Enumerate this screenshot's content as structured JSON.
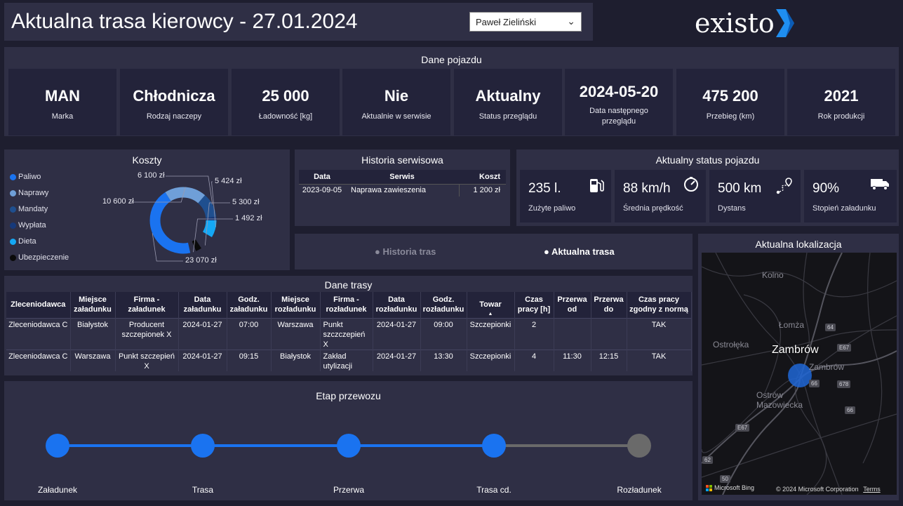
{
  "header": {
    "title": "Aktualna trasa kierowcy - 27.01.2024",
    "driver_selected": "Paweł Zieliński",
    "logo_text": "existo"
  },
  "vehicle": {
    "title": "Dane pojazdu",
    "kpis": [
      {
        "value": "MAN",
        "label": "Marka"
      },
      {
        "value": "Chłodnicza",
        "label": "Rodzaj naczepy"
      },
      {
        "value": "25 000",
        "label": "Ładowność [kg]"
      },
      {
        "value": "Nie",
        "label": "Aktualnie w serwisie"
      },
      {
        "value": "Aktualny",
        "label": "Status przeglądu"
      },
      {
        "value": "2024-05-20",
        "label": "Data następnego przeglądu"
      },
      {
        "value": "475 200",
        "label": "Przebieg (km)"
      },
      {
        "value": "2021",
        "label": "Rok produkcji"
      }
    ]
  },
  "costs": {
    "title": "Koszty",
    "legend": [
      {
        "name": "Paliwo",
        "color": "#1a73f0"
      },
      {
        "name": "Naprawy",
        "color": "#6f9fd8"
      },
      {
        "name": "Mandaty",
        "color": "#1f4f8f"
      },
      {
        "name": "Wypłata",
        "color": "#16397a"
      },
      {
        "name": "Dieta",
        "color": "#14a8f5"
      },
      {
        "name": "Ubezpieczenie",
        "color": "#0a0a0a"
      }
    ]
  },
  "chart_data": {
    "type": "pie",
    "title": "Koszty",
    "categories": [
      "Paliwo",
      "Naprawy",
      "Mandaty",
      "Wypłata",
      "Dieta",
      "Ubezpieczenie"
    ],
    "values": [
      23070,
      10600,
      6100,
      5424,
      5300,
      1492
    ],
    "value_labels": [
      "23 070 zł",
      "10 600 zł",
      "6 100 zł",
      "5 424 zł",
      "5 300 zł",
      "1 492 zł"
    ],
    "donut": true
  },
  "service": {
    "title": "Historia serwisowa",
    "columns": [
      "Data",
      "Serwis",
      "Koszt"
    ],
    "rows": [
      {
        "date": "2023-09-05",
        "service": "Naprawa zawieszenia",
        "cost": "1 200 zł"
      }
    ]
  },
  "status": {
    "title": "Aktualny status pojazdu",
    "cards": [
      {
        "value": "235 l.",
        "label": "Zużyte paliwo",
        "icon": "fuel-pump-icon"
      },
      {
        "value": "88 km/h",
        "label": "Średnia prędkość",
        "icon": "speedometer-icon"
      },
      {
        "value": "500 km",
        "label": "Dystans",
        "icon": "route-pin-icon"
      },
      {
        "value": "90%",
        "label": "Stopień załadunku",
        "icon": "truck-icon"
      }
    ]
  },
  "toggle": {
    "history": "Historia tras",
    "current": "Aktualna trasa"
  },
  "route": {
    "title": "Dane trasy",
    "columns": [
      "Zleceniodawca",
      "Miejsce załadunku",
      "Firma - załadunek",
      "Data załadunku",
      "Godz. załadunku",
      "Miejsce rozładunku",
      "Firma - rozładunek",
      "Data rozładunku",
      "Godz. rozładunku",
      "Towar",
      "Czas pracy [h]",
      "Przerwa od",
      "Przerwa do",
      "Czas pracy zgodny z normą"
    ],
    "rows": [
      [
        "Zleceniodawca C",
        "Białystok",
        "Producent szczepionek X",
        "2024-01-27",
        "07:00",
        "Warszawa",
        "Punkt szczczepień X",
        "2024-01-27",
        "09:00",
        "Szczepionki",
        "2",
        "",
        "",
        "TAK"
      ],
      [
        "Zleceniodawca C",
        "Warszawa",
        "Punkt szczepień X",
        "2024-01-27",
        "09:15",
        "Białystok",
        "Zakład utylizacji",
        "2024-01-27",
        "13:30",
        "Szczepionki",
        "4",
        "11:30",
        "12:15",
        "TAK"
      ]
    ]
  },
  "stages": {
    "title": "Etap przewozu",
    "items": [
      {
        "label": "Załadunek",
        "done": true
      },
      {
        "label": "Trasa",
        "done": true
      },
      {
        "label": "Przerwa",
        "done": true
      },
      {
        "label": "Trasa cd.",
        "done": true
      },
      {
        "label": "Rozładunek",
        "done": false
      }
    ],
    "active_color": "#1a73f0",
    "inactive_color": "#6a6a6a"
  },
  "map": {
    "title": "Aktualna lokalizacja",
    "location": "Zambrów",
    "places": [
      "Kolno",
      "Łomża",
      "Ostrołęka",
      "Zambrów",
      "Ostrów Mazowiecka"
    ],
    "road_badges": [
      "64",
      "E67",
      "66",
      "678",
      "66",
      "E67",
      "62",
      "50"
    ],
    "attribution": "Microsoft Bing",
    "copyright": "© 2024 Microsoft Corporation",
    "terms": "Terms"
  }
}
